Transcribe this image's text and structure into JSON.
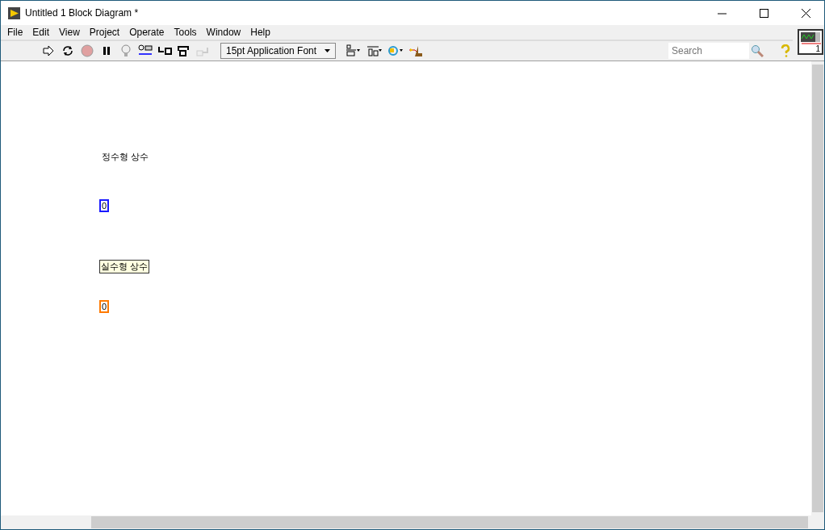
{
  "window": {
    "title": "Untitled 1 Block Diagram *"
  },
  "menu": [
    "File",
    "Edit",
    "View",
    "Project",
    "Operate",
    "Tools",
    "Window",
    "Help"
  ],
  "toolbar": {
    "font": "15pt Application Font",
    "search": {
      "placeholder": "Search"
    }
  },
  "vi_icon": {
    "terminal_number": "1"
  },
  "diagram": [
    {
      "label": "정수형 상수",
      "label_boxed": false,
      "value": "0",
      "color": "#1a1aff"
    },
    {
      "label": "실수형 상수",
      "label_boxed": true,
      "value": "0",
      "color": "#ff7a00"
    }
  ]
}
